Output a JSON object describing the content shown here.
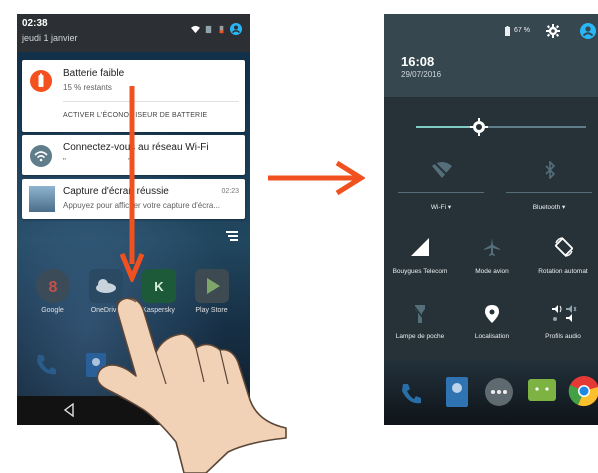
{
  "left_screen": {
    "status_bar": {
      "time": "02:38",
      "date": "jeudi 1 janvier"
    },
    "notifications": [
      {
        "title": "Batterie faible",
        "subtitle": "15 % restants",
        "action": "ACTIVER L'ÉCONOMISEUR DE BATTERIE",
        "icon": "battery-alert-icon"
      },
      {
        "title": "Connectez-vous au réseau Wi-Fi",
        "subtitle": "\"              \"",
        "icon": "wifi-icon"
      },
      {
        "title": "Capture d'écran réussie",
        "subtitle": "Appuyez pour afficher votre capture d'écra...",
        "time": "02:23",
        "icon": "screenshot-thumbnail"
      }
    ],
    "home_apps": [
      {
        "label": "Google",
        "icon": "google-icon"
      },
      {
        "label": "OneDrive",
        "icon": "onedrive-icon"
      },
      {
        "label": "Kaspersky",
        "icon": "kaspersky-icon"
      },
      {
        "label": "Play Store",
        "icon": "play-store-icon"
      }
    ]
  },
  "right_screen": {
    "header": {
      "battery": "67 %",
      "time": "16:08",
      "date": "29/07/2016"
    },
    "tiles_row1": [
      {
        "label": "Wi-Fi",
        "icon": "wifi-off-icon"
      },
      {
        "label": "Bluetooth",
        "icon": "bluetooth-icon"
      }
    ],
    "tiles_row2": [
      {
        "label": "Bouygues Telecom",
        "icon": "signal-icon"
      },
      {
        "label": "Mode avion",
        "icon": "airplane-icon"
      },
      {
        "label": "Rotation automat",
        "icon": "rotation-icon"
      }
    ],
    "tiles_row3": [
      {
        "label": "Lampe de poche",
        "icon": "flashlight-icon"
      },
      {
        "label": "Localisation",
        "icon": "location-icon"
      },
      {
        "label": "Profils audio",
        "icon": "audio-profile-icon"
      }
    ],
    "brightness_level": 0.37
  },
  "colors": {
    "accent_arrow": "#f0511e",
    "battery_alert": "#f4511e",
    "brightness_fill": "#80cbc4"
  }
}
